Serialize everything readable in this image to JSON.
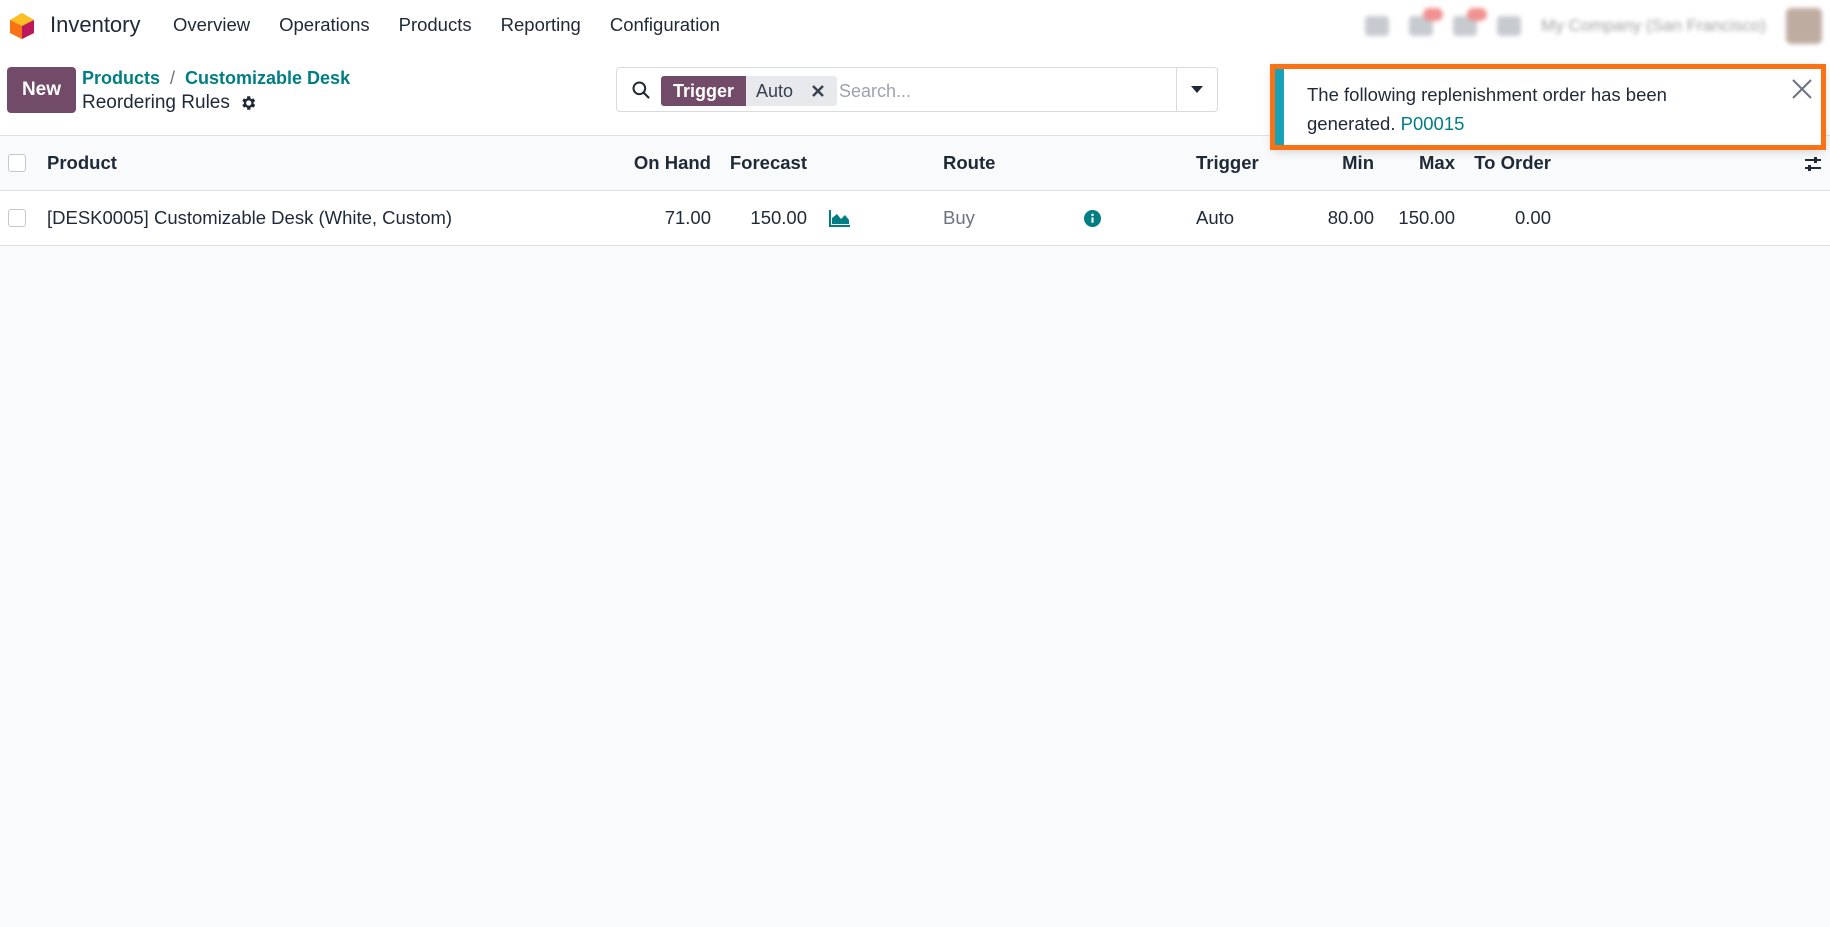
{
  "navbar": {
    "app_name": "Inventory",
    "menu": [
      "Overview",
      "Operations",
      "Products",
      "Reporting",
      "Configuration"
    ],
    "company": "My Company (San Francisco)"
  },
  "control_panel": {
    "new_label": "New",
    "breadcrumb": [
      "Products",
      "Customizable Desk"
    ],
    "breadcrumb_separator": "/",
    "page_title": "Reordering Rules",
    "search": {
      "facet_label": "Trigger",
      "facet_value": "Auto",
      "placeholder": "Search..."
    }
  },
  "table": {
    "columns": {
      "product": "Product",
      "on_hand": "On Hand",
      "forecast": "Forecast",
      "route": "Route",
      "trigger": "Trigger",
      "min": "Min",
      "max": "Max",
      "to_order": "To Order"
    },
    "rows": [
      {
        "product": "[DESK0005] Customizable Desk (White, Custom)",
        "on_hand": "71.00",
        "forecast": "150.00",
        "route": "Buy",
        "trigger": "Auto",
        "min": "80.00",
        "max": "150.00",
        "to_order": "0.00"
      }
    ]
  },
  "notification": {
    "message": "The following replenishment order has been generated.",
    "link": "P00015"
  },
  "colors": {
    "brand": "#714b67",
    "link": "#017e84",
    "info": "#17a2b8",
    "highlight": "#f97316"
  }
}
